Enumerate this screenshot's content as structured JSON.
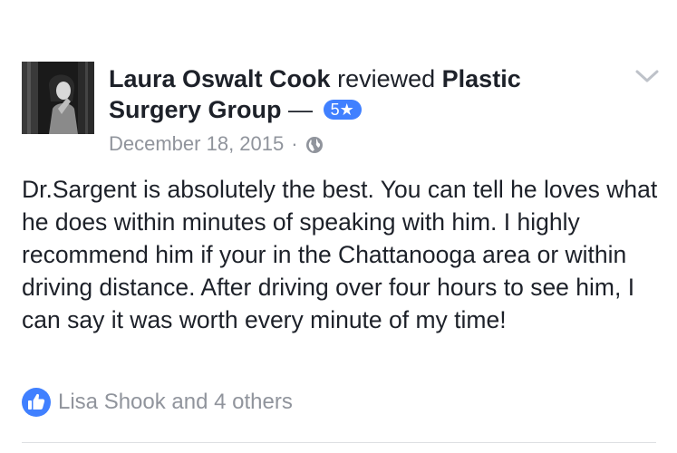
{
  "review": {
    "author": "Laura Oswalt Cook",
    "action": "reviewed",
    "page_name": "Plastic Surgery Group",
    "dash": "—",
    "rating": "5★",
    "date": "December 18, 2015",
    "separator": "·",
    "privacy_icon": "globe-icon",
    "body": "Dr.Sargent is absolutely the best. You can tell he loves what he does within minutes of speaking with him. I highly recommend him if your in the Chattanooga area or within driving distance. After driving over four hours to see him, I can say it was worth every minute of my time!"
  },
  "reactions": {
    "icon": "like-icon",
    "text": "Lisa Shook and 4 others"
  },
  "menu": {
    "icon": "chevron-down-icon"
  },
  "colors": {
    "text": "#1d2129",
    "secondary": "#90949c",
    "accent": "#4080ff",
    "divider": "#dddfe2"
  }
}
